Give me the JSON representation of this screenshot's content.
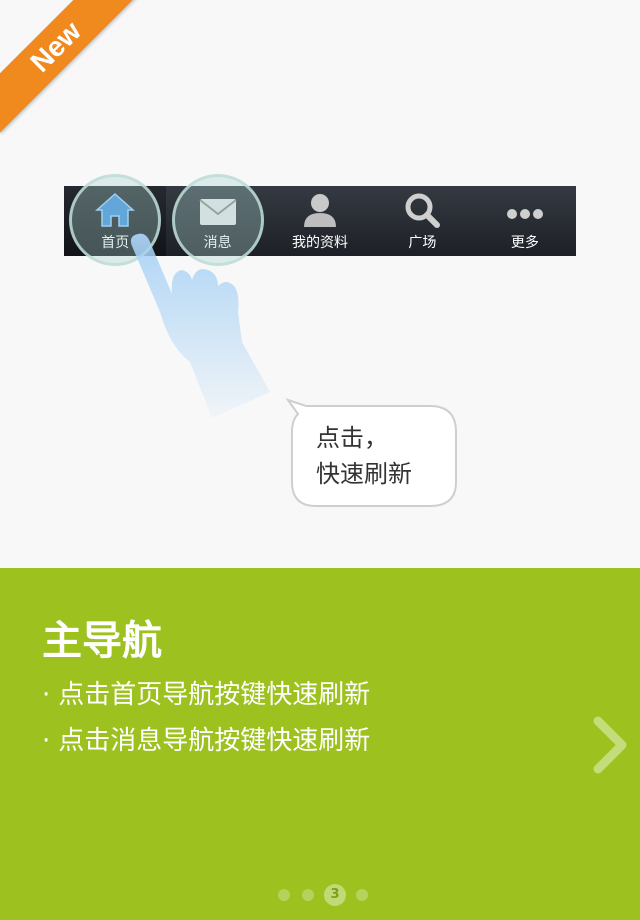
{
  "badge": {
    "label": "New"
  },
  "navbar": {
    "items": [
      {
        "label": "首页",
        "icon": "home-icon",
        "active": true
      },
      {
        "label": "消息",
        "icon": "mail-icon",
        "active": false
      },
      {
        "label": "我的资料",
        "icon": "user-icon",
        "active": false
      },
      {
        "label": "广场",
        "icon": "search-icon",
        "active": false
      },
      {
        "label": "更多",
        "icon": "more-icon",
        "active": false
      }
    ]
  },
  "bubble": {
    "line1": "点击，",
    "line2": "快速刷新"
  },
  "feature": {
    "title": "主导航",
    "bullets": [
      "点击首页导航按键快速刷新",
      "点击消息导航按键快速刷新"
    ],
    "bullet_mark": "·"
  },
  "pager": {
    "current_label": "3",
    "total": 4,
    "current": 3
  },
  "colors": {
    "accent": "#9dc11f",
    "badge": "#f08a1f",
    "navbar": "#1d2026"
  }
}
